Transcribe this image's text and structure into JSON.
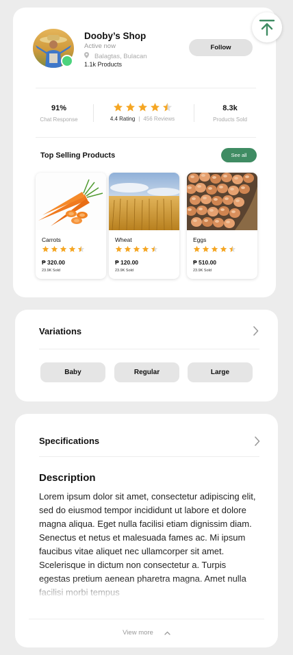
{
  "shop": {
    "name": "Dooby’s Shop",
    "status": "Active now",
    "location": "Balagtas, Bulacan",
    "products": "1.1k Products",
    "follow_label": "Follow"
  },
  "stats": {
    "chat_response_value": "91%",
    "chat_response_label": "Chat Response",
    "rating_stars": 4.5,
    "rating_label": "4.4 Rating",
    "separator": "|",
    "reviews_label": "456 Reviews",
    "sold_value": "8.3k",
    "sold_label": "Products Sold"
  },
  "top_selling": {
    "title": "Top Selling Products",
    "see_all_label": "See all",
    "items": [
      {
        "name": "Carrots",
        "stars": 4.5,
        "price": "₱ 320.00",
        "sold": "23.9K Sold"
      },
      {
        "name": "Wheat",
        "stars": 4.5,
        "price": "₱ 120.00",
        "sold": "23.9K Sold"
      },
      {
        "name": "Eggs",
        "stars": 4.5,
        "price": "₱ 510.00",
        "sold": "23.9K Sold"
      }
    ]
  },
  "variations": {
    "title": "Variations",
    "options": [
      "Baby",
      "Regular",
      "Large"
    ]
  },
  "specifications": {
    "title": "Specifications"
  },
  "description": {
    "title": "Description",
    "text": "Lorem ipsum dolor sit amet, consectetur adipiscing elit, sed do eiusmod tempor incididunt ut labore et dolore magna aliqua. Eget nulla facilisi etiam dignissim diam. Senectus et netus et malesuada fames ac. Mi ipsum faucibus vitae aliquet nec ullamcorper sit amet. Scelerisque in dictum non consectetur a. Turpis egestas pretium aenean pharetra magna. Amet nulla facilisi morbi tempus",
    "view_more_label": "View more"
  },
  "colors": {
    "accent": "#3f8c63",
    "star": "#f5a623",
    "online": "#4cd37d",
    "background": "#ececec"
  },
  "icons": {
    "scroll_top": "arrow-up-to-line-icon",
    "location": "location-pin-icon",
    "chevron": "chevron-right-icon",
    "view_more": "chevron-up-icon",
    "star": "star-icon"
  }
}
